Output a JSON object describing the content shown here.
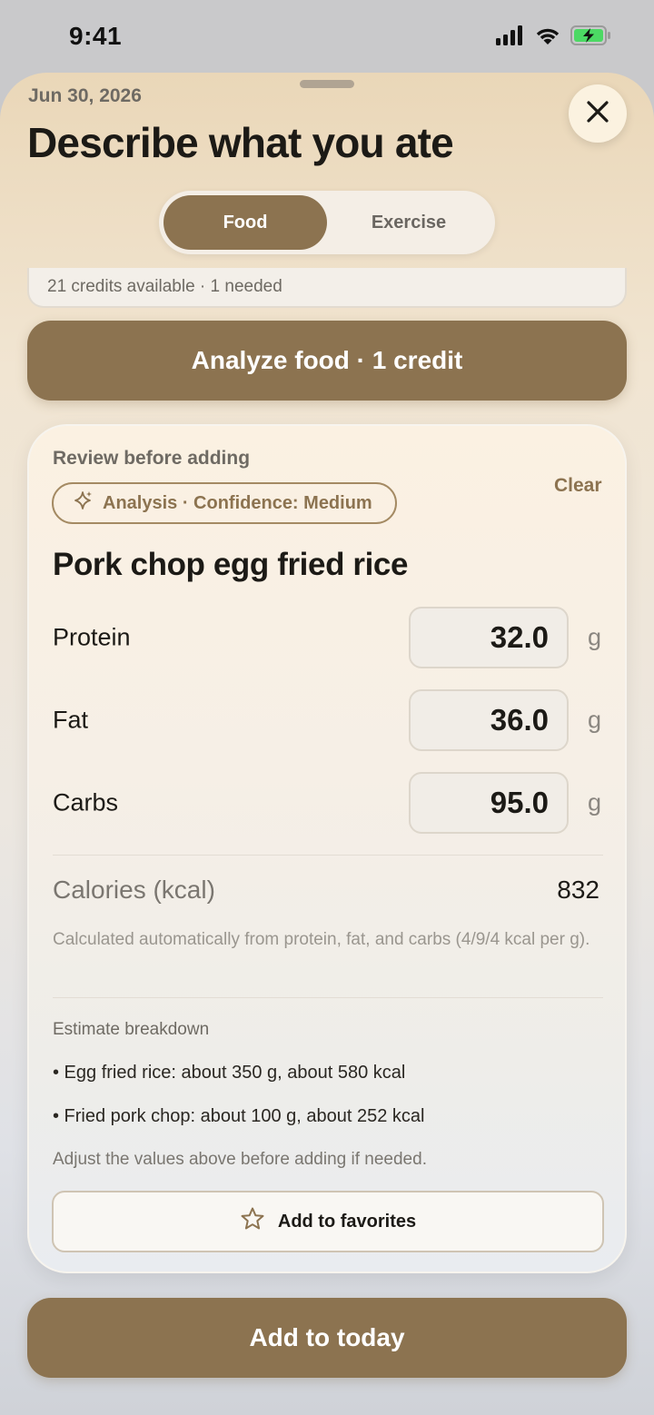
{
  "status_bar": {
    "time": "9:41"
  },
  "header": {
    "date": "Jun 30, 2026",
    "title": "Describe what you ate"
  },
  "tabs": [
    {
      "label": "Food",
      "active": true
    },
    {
      "label": "Exercise",
      "active": false
    }
  ],
  "credits": {
    "text": "21 credits available · 1 needed"
  },
  "analyze_button": {
    "label": "Analyze food · 1 credit"
  },
  "review": {
    "heading": "Review before adding",
    "clear_label": "Clear",
    "confidence_label": "Analysis · Confidence: Medium",
    "food_name": "Pork chop egg fried rice",
    "macros": [
      {
        "label": "Protein",
        "value": "32.0",
        "unit": "g"
      },
      {
        "label": "Fat",
        "value": "36.0",
        "unit": "g"
      },
      {
        "label": "Carbs",
        "value": "95.0",
        "unit": "g"
      }
    ],
    "calories_label": "Calories (kcal)",
    "calories_value": "832",
    "calories_note": "Calculated automatically from protein, fat, and carbs (4/9/4 kcal per g).",
    "breakdown_title": "Estimate breakdown",
    "breakdown_items": [
      "• Egg fried rice: about 350 g, about 580 kcal",
      "• Fried pork chop: about 100 g, about 252 kcal"
    ],
    "adjust_note": "Adjust the values above before adding if needed.",
    "favorites_label": "Add to favorites"
  },
  "add_button": {
    "label": "Add to today"
  },
  "colors": {
    "accent": "#8c7350",
    "accent_text": "#ffffff"
  }
}
